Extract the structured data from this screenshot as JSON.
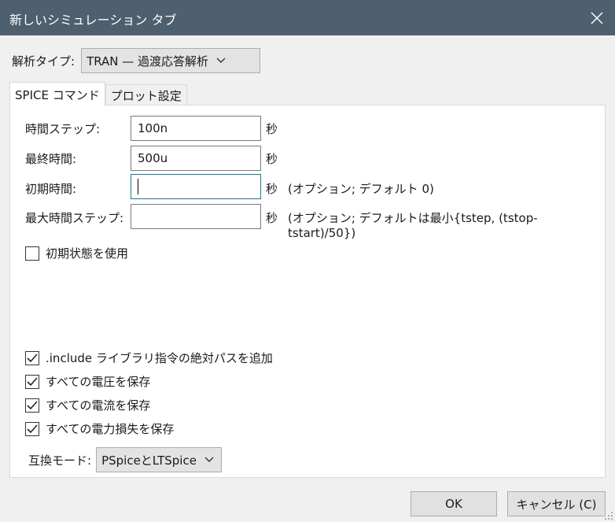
{
  "window": {
    "title": "新しいシミュレーション タブ"
  },
  "analysis": {
    "label": "解析タイプ:",
    "selected": "TRAN — 過渡応答解析"
  },
  "tabs": [
    {
      "label": "SPICE コマンド",
      "active": true
    },
    {
      "label": "プロット設定",
      "active": false
    }
  ],
  "fields": [
    {
      "label": "時間ステップ:",
      "value": "100n",
      "unit": "秒",
      "note": ""
    },
    {
      "label": "最終時間:",
      "value": "500u",
      "unit": "秒",
      "note": ""
    },
    {
      "label": "初期時間:",
      "value": "",
      "unit": "秒",
      "note": "(オプション; デフォルト 0)"
    },
    {
      "label": "最大時間ステップ:",
      "value": "",
      "unit": "秒",
      "note": "(オプション; デフォルトは最小{tstep, (tstop-tstart)/50})"
    }
  ],
  "checkboxes": [
    {
      "label": "初期状態を使用",
      "checked": false
    },
    {
      "label": ".include ライブラリ指令の絶対パスを追加",
      "checked": true
    },
    {
      "label": "すべての電圧を保存",
      "checked": true
    },
    {
      "label": "すべての電流を保存",
      "checked": true
    },
    {
      "label": "すべての電力損失を保存",
      "checked": true
    }
  ],
  "compat": {
    "label": "互換モード:",
    "selected": "PSpiceとLTSpice"
  },
  "buttons": {
    "ok": "OK",
    "cancel": "キャンセル (C)"
  },
  "icons": [
    "close-icon",
    "chevron-down-icon",
    "checkmark-icon",
    "resize-grip-icon"
  ]
}
